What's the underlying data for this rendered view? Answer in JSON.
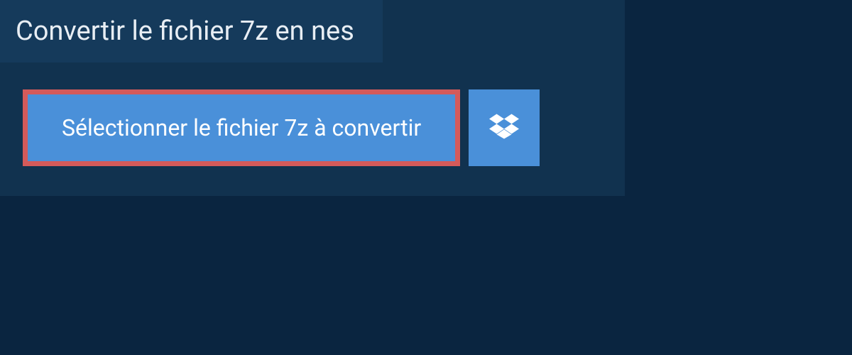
{
  "title": "Convertir le fichier 7z en nes",
  "actions": {
    "select_file_label": "Sélectionner le fichier 7z à convertir",
    "dropbox_icon": "dropbox"
  },
  "colors": {
    "page_bg": "#0a2540",
    "panel_bg": "#11324f",
    "title_bg": "#153a5b",
    "button_bg": "#4a90d9",
    "highlight_border": "#d45a5a",
    "text_light": "#ffffff"
  }
}
